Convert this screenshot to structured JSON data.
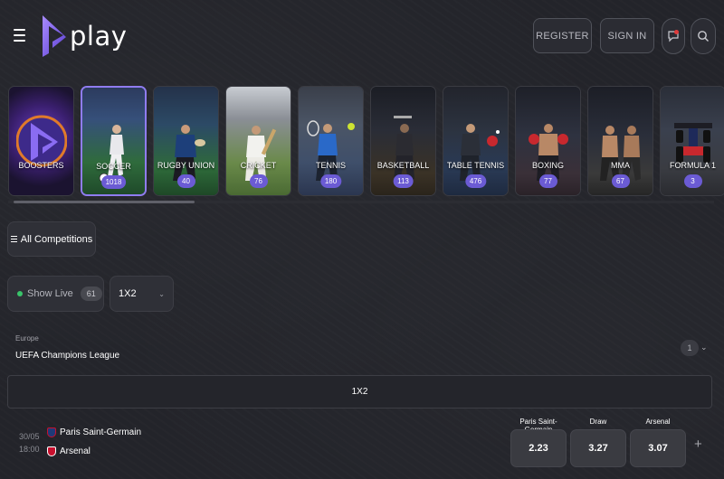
{
  "header": {
    "logo_text": "play",
    "register_label": "REGISTER",
    "signin_label": "SIGN IN"
  },
  "sports": [
    {
      "label": "BOOSTERS",
      "count": "",
      "active": false
    },
    {
      "label": "SOCCER",
      "count": "1018",
      "active": true
    },
    {
      "label": "RUGBY UNION",
      "count": "40",
      "active": false
    },
    {
      "label": "CRICKET",
      "count": "76",
      "active": false
    },
    {
      "label": "TENNIS",
      "count": "180",
      "active": false
    },
    {
      "label": "BASKETBALL",
      "count": "113",
      "active": false
    },
    {
      "label": "TABLE TENNIS",
      "count": "476",
      "active": false
    },
    {
      "label": "BOXING",
      "count": "77",
      "active": false
    },
    {
      "label": "MMA",
      "count": "67",
      "active": false
    },
    {
      "label": "FORMULA 1",
      "count": "3",
      "active": false
    }
  ],
  "filters": {
    "all_competitions_label": "All Competitions",
    "show_live_label": "Show Live",
    "live_count": "61",
    "market_selected": "1X2"
  },
  "league": {
    "region": "Europe",
    "name": "UEFA Champions League",
    "count": "1",
    "market_header": "1X2"
  },
  "match": {
    "date": "30/05",
    "time": "18:00",
    "home": "Paris Saint-Germain",
    "away": "Arsenal",
    "odds": [
      {
        "label": "Paris Saint-Germain",
        "value": "2.23"
      },
      {
        "label": "Draw",
        "value": "3.27"
      },
      {
        "label": "Arsenal",
        "value": "3.07"
      }
    ],
    "more_label": "+"
  },
  "colors": {
    "accent": "#6b5bd4",
    "active_border": "#8f7cf0",
    "background": "#23242a",
    "live": "#39c46a"
  }
}
